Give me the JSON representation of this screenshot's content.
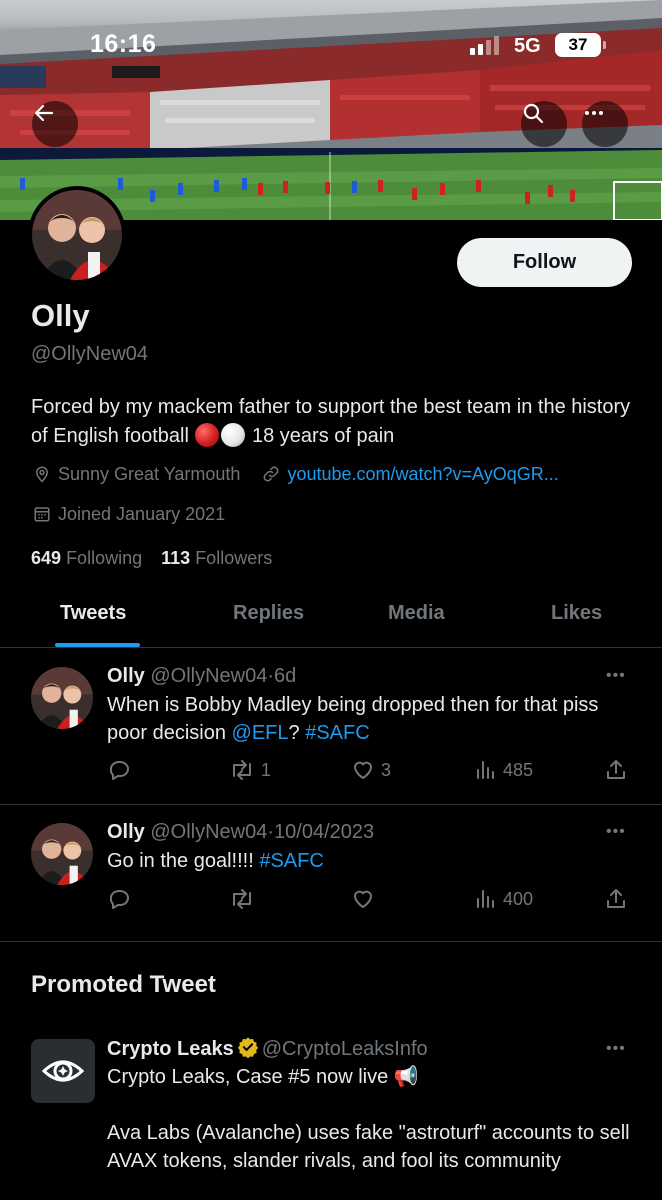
{
  "status_bar": {
    "time": "16:16",
    "network": "5G",
    "battery": "37"
  },
  "profile": {
    "name": "Olly",
    "handle": "@OllyNew04",
    "follow_label": "Follow",
    "bio_part1": "Forced by my mackem father to support the best team in the history of English football ",
    "bio_part2": " 18 years of pain",
    "location": "Sunny Great Yarmouth",
    "website": "youtube.com/watch?v=AyOqGR...",
    "joined": "Joined January 2021",
    "following_count": "649",
    "following_label": "Following",
    "followers_count": "113",
    "followers_label": "Followers"
  },
  "tabs": [
    {
      "label": "Tweets",
      "active": true
    },
    {
      "label": "Replies",
      "active": false
    },
    {
      "label": "Media",
      "active": false
    },
    {
      "label": "Likes",
      "active": false
    }
  ],
  "tweets": [
    {
      "author": "Olly",
      "handle": "@OllyNew04",
      "sep": "·",
      "time": "6d",
      "text_part1": "When is Bobby Madley being dropped then for that piss poor decision ",
      "mention": "@EFL",
      "text_part2": "? ",
      "hashtag": "#SAFC",
      "retweets": "1",
      "likes": "3",
      "views": "485"
    },
    {
      "author": "Olly",
      "handle": "@OllyNew04",
      "sep": "·",
      "time": "10/04/2023",
      "text_part1": "Go in the goal!!!! ",
      "hashtag": "#SAFC",
      "views": "400"
    }
  ],
  "promoted": {
    "section_title": "Promoted Tweet",
    "author": "Crypto Leaks",
    "handle": "@CryptoLeaksInfo",
    "line1": "Crypto Leaks, Case #5 now live 📢",
    "line2": "Ava Labs (Avalanche) uses fake \"astroturf\" accounts to sell AVAX tokens, slander rivals, and fool its community"
  },
  "icons": {
    "back": "arrow-left-icon",
    "search": "search-icon",
    "more": "more-horizontal-icon",
    "location": "location-pin-icon",
    "link": "link-icon",
    "calendar": "calendar-icon",
    "reply": "reply-icon",
    "retweet": "retweet-icon",
    "like": "heart-icon",
    "views": "views-bar-icon",
    "share": "share-icon",
    "verified": "gold-verified-badge-icon"
  },
  "colors": {
    "accent": "#1d9bf0",
    "muted": "#71767b",
    "verified_gold": "#e2b719"
  }
}
